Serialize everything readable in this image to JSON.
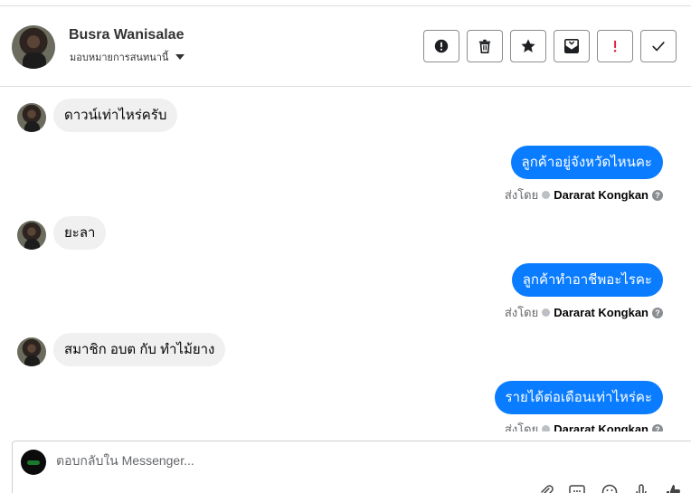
{
  "header": {
    "contact_name": "Busra Wanisalae",
    "assign_label": "มอบหมายการสนทนานี้",
    "actions": [
      {
        "name": "spam-button",
        "icon": "exclamation-circle-icon"
      },
      {
        "name": "delete-button",
        "icon": "trash-icon"
      },
      {
        "name": "star-button",
        "icon": "star-icon"
      },
      {
        "name": "mark-unread-button",
        "icon": "envelope-icon"
      },
      {
        "name": "follow-up-button",
        "icon": "red-exclamation-icon"
      },
      {
        "name": "mark-done-button",
        "icon": "checkmark-icon"
      }
    ]
  },
  "messages": [
    {
      "direction": "in",
      "text": "ดาวน์เท่าไหร่ครับ"
    },
    {
      "direction": "out",
      "text": "ลูกค้าอยู่จังหวัดไหนคะ",
      "sent_by_label": "ส่งโดย",
      "agent": "Dararat Kongkan"
    },
    {
      "direction": "in",
      "text": "ยะลา"
    },
    {
      "direction": "out",
      "text": "ลูกค้าทำอาชีพอะไรคะ",
      "sent_by_label": "ส่งโดย",
      "agent": "Dararat Kongkan"
    },
    {
      "direction": "in",
      "text": "สมาชิก อบต กับ ทำไม้ยาง"
    },
    {
      "direction": "out",
      "text": "รายได้ต่อเดือนเท่าไหร่คะ",
      "sent_by_label": "ส่งโดย",
      "agent": "Dararat Kongkan"
    }
  ],
  "composer": {
    "placeholder": "ตอบกลับใน Messenger..."
  },
  "colors": {
    "outgoing_bubble": "#0a7cff",
    "incoming_bubble": "#f0f0f0",
    "follow_up_icon": "#e41e3f"
  }
}
